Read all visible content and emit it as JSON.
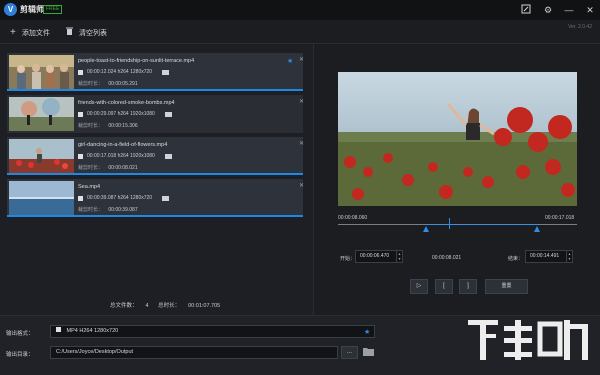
{
  "app": {
    "logo_letter": "V",
    "title": "剪辑师",
    "badge": "FREE",
    "version": "Ver. 2.0.42"
  },
  "toolbar": {
    "add_file": "添加文件",
    "clear_list": "清空列表"
  },
  "files": [
    {
      "name": "people-toast-to-friendship-on-sunlit-terrace.mp4",
      "meta": "00:00:12.024  h264  1280x720",
      "duration_label": "裁剪时长：",
      "duration": "00:00:05.291",
      "starred": true,
      "active": true
    },
    {
      "name": "friends-with-colored-smoke-bombs.mp4",
      "meta": "00:00:29.097  h264  1920x1080",
      "duration_label": "裁剪时长：",
      "duration": "00:00:15.306",
      "starred": false,
      "active": false
    },
    {
      "name": "girl-dancing-in-a-field-of-flowers.mp4",
      "meta": "00:00:17.018  h264  1920x1080",
      "duration_label": "裁剪时长：",
      "duration": "00:00:08.021",
      "starred": false,
      "active": true
    },
    {
      "name": "Sea.mp4",
      "meta": "00:00:39.087  h264  1280x720",
      "duration_label": "裁剪时长：",
      "duration": "00:00:39.087",
      "starred": false,
      "active": true
    }
  ],
  "summary": {
    "count_label": "总文件数：",
    "count": "4",
    "total_label": "总时长：",
    "total": "00:01:07.705"
  },
  "player": {
    "time_start": "00:00:08.060",
    "time_end": "00:00:17.018",
    "start_label": "开始：",
    "start_value": "00:00:06.470",
    "mid_value": "00:00:08.021",
    "end_label": "结束：",
    "end_value": "00:00:14.491",
    "play_icon": "▷",
    "mark_in": "[",
    "mark_out": "]",
    "reset": "重置"
  },
  "output": {
    "format_label": "输出格式：",
    "format_value": "MP4 H264 1280x720",
    "dir_label": "输出目录：",
    "dir_value": "C:/Users/Joyce/Desktop/Output",
    "browse": "..."
  },
  "colors": {
    "accent": "#1e88e5",
    "bg": "#1b1d21",
    "free": "#3aa83a"
  }
}
